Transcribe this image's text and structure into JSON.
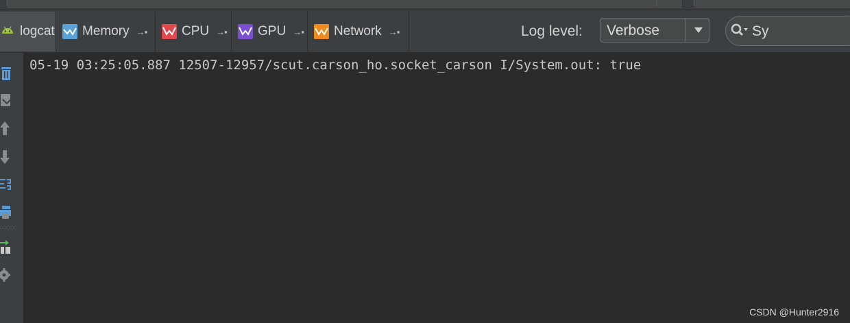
{
  "tabs": [
    {
      "label": "logcat",
      "icon": "android-icon",
      "active": true
    },
    {
      "label": "Memory",
      "icon": "memory-monitor-icon",
      "color": "#5aa2d6"
    },
    {
      "label": "CPU",
      "icon": "cpu-monitor-icon",
      "color": "#e0484e"
    },
    {
      "label": "GPU",
      "icon": "gpu-monitor-icon",
      "color": "#7b4fd0"
    },
    {
      "label": "Network",
      "icon": "network-monitor-icon",
      "color": "#f08a1c"
    }
  ],
  "log_level": {
    "label": "Log level:",
    "selected": "Verbose"
  },
  "search": {
    "value": "Sy"
  },
  "sidebar": {
    "icons": [
      "trash-icon",
      "soft-wrap-icon",
      "scroll-up-icon",
      "scroll-down-icon",
      "format-icon",
      "print-icon",
      "restart-icon",
      "settings-icon"
    ]
  },
  "log": {
    "lines": [
      "05-19 03:25:05.887 12507-12957/scut.carson_ho.socket_carson I/System.out: true"
    ]
  },
  "watermark": "CSDN @Hunter2916",
  "colors": {
    "background": "#2b2b2b",
    "toolbar": "#3c3f41",
    "text": "#c8c8c8"
  }
}
